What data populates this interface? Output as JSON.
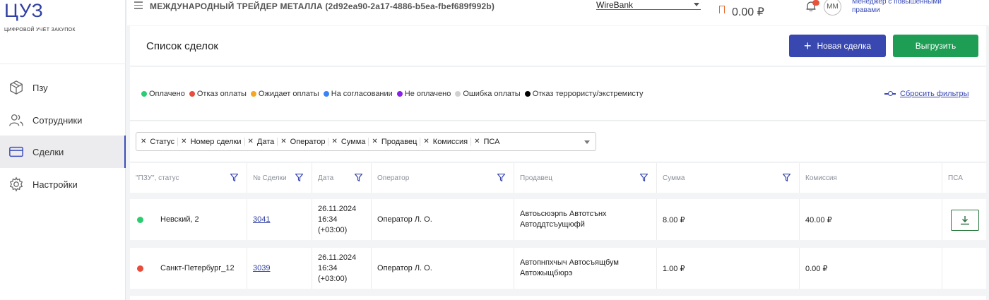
{
  "brand": {
    "logo": "ЦУЗ",
    "subtitle": "ЦИФРОВОЙ УЧЁТ ЗАКУПОК"
  },
  "sidebar": {
    "items": [
      {
        "label": "Пзу",
        "icon": "cube-icon",
        "active": false
      },
      {
        "label": "Сотрудники",
        "icon": "users-icon",
        "active": false
      },
      {
        "label": "Сделки",
        "icon": "card-icon",
        "active": true
      },
      {
        "label": "Настройки",
        "icon": "gear-icon",
        "active": false
      }
    ]
  },
  "header": {
    "company": "МЕЖДУНАРОДНЫЙ ТРЕЙДЕР МЕТАЛЛА (2d92ea90-2a17-4886-b5ea-fbef689f992b)",
    "bank": "WireBank",
    "balance": "0.00 ₽",
    "avatar": "ММ",
    "user_role": "Менеджер с повышенными правами"
  },
  "page": {
    "title": "Список сделок",
    "new_button": "Новая сделка",
    "export_button": "Выгрузить"
  },
  "legend": {
    "items": [
      {
        "label": "Оплачено",
        "color": "#2ecc71"
      },
      {
        "label": "Отказ оплаты",
        "color": "#e74c3c"
      },
      {
        "label": "Ожидает оплаты",
        "color": "#f5a623"
      },
      {
        "label": "На согласовании",
        "color": "#3b82f6"
      },
      {
        "label": "Не оплачено",
        "color": "#8b1ee8"
      },
      {
        "label": "Ошибка оплаты",
        "color": "#d0d0d0"
      },
      {
        "label": "Отказ террористу/экстремисту",
        "color": "#000000"
      }
    ],
    "reset": "Сбросить фильтры"
  },
  "column_filter": {
    "chips": [
      "Статус",
      "Номер сделки",
      "Дата",
      "Оператор",
      "Сумма",
      "Продавец",
      "Комиссия",
      "ПСА"
    ]
  },
  "table": {
    "headers": [
      "\"ПЗУ\", статус",
      "№ Сделки",
      "Дата",
      "Оператор",
      "Продавец",
      "Сумма",
      "Комиссия",
      "ПСА"
    ],
    "rows": [
      {
        "status_color": "#2ecc71",
        "pzu": "Невский, 2",
        "deal": "3041",
        "date": "26.11.2024",
        "time": "16:34",
        "tz": "(+03:00)",
        "operator": "Оператор Л. О.",
        "seller_line1": "Автоьсюэрпь Автотсънх",
        "seller_line2": "Автоддтсъущюфй",
        "sum": "8.00 ₽",
        "commission": "40.00 ₽",
        "psa_download": true
      },
      {
        "status_color": "#e74c3c",
        "pzu": "Санкт-Петербург_12",
        "deal": "3039",
        "date": "26.11.2024",
        "time": "16:34",
        "tz": "(+03:00)",
        "operator": "Оператор Л. О.",
        "seller_line1": "Автопнпхчыч Автосъящбум",
        "seller_line2": "Автожыщбюрэ",
        "sum": "1.00 ₽",
        "commission": "0.00 ₽",
        "psa_download": false
      }
    ]
  },
  "colors": {
    "accent": "#3848b0",
    "export": "#1e9e55"
  }
}
